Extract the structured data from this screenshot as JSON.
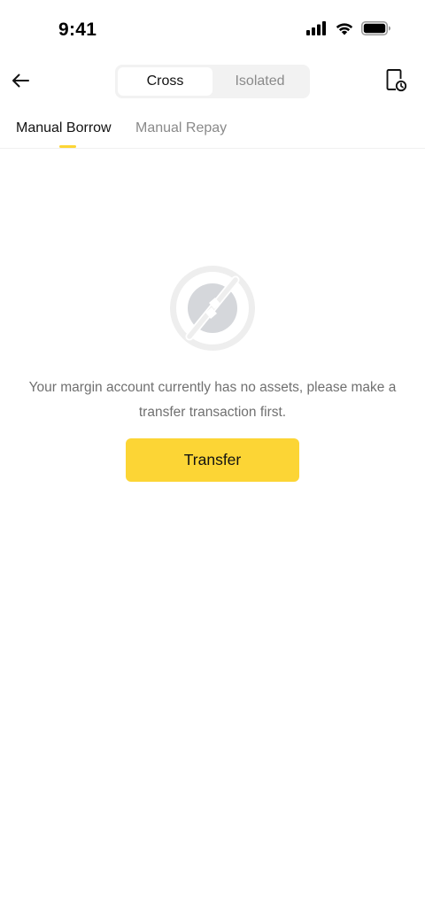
{
  "status_bar": {
    "time": "9:41",
    "icons": [
      "cellular-signal-icon",
      "wifi-icon",
      "battery-icon"
    ]
  },
  "header": {
    "back_icon": "back-arrow-icon",
    "segments": [
      {
        "label": "Cross",
        "active": true
      },
      {
        "label": "Isolated",
        "active": false
      }
    ],
    "history_icon": "document-history-icon"
  },
  "sub_tabs": [
    {
      "label": "Manual Borrow",
      "active": true
    },
    {
      "label": "Manual Repay",
      "active": false
    }
  ],
  "empty_state": {
    "icon": "no-assets-icon",
    "message": "Your margin account currently has no assets, please make a transfer transaction first.",
    "button_label": "Transfer"
  },
  "colors": {
    "accent": "#FCD535",
    "text_primary": "#121212",
    "text_secondary": "#707070",
    "segment_bg": "#F2F2F2"
  }
}
